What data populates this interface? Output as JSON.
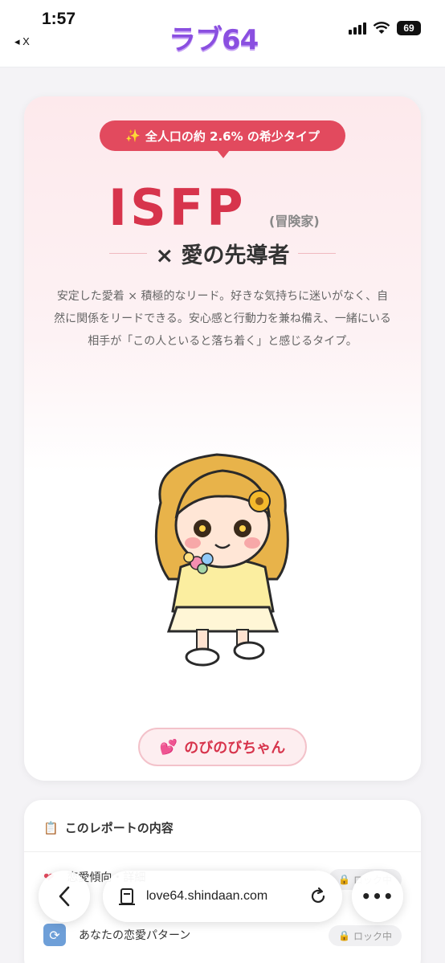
{
  "status_bar": {
    "time": "1:57",
    "back_label": "◂ X",
    "battery": "69"
  },
  "app": {
    "logo": "ラブ64"
  },
  "result": {
    "rarity_badge": "全人口の約 2.6% の希少タイプ",
    "sparkle": "✨",
    "type_code": "ISFP",
    "type_name": "(冒険家)",
    "subtitle": "× 愛の先導者",
    "description": "安定した愛着 × 積極的なリード。好きな気持ちに迷いがなく、自然に関係をリードできる。安心感と行動力を兼ね備え、一緒にいる相手が「この人といると落ち着く」と感じるタイプ。",
    "nickname_icon": "💕",
    "nickname": "のびのびちゃん"
  },
  "report": {
    "icon": "📋",
    "title": "このレポートの内容",
    "items": [
      {
        "label": "恋愛傾向・詳細",
        "status": "ロック中"
      },
      {
        "label": "あなたの恋愛パターン",
        "status": "ロック中"
      }
    ]
  },
  "browser": {
    "url": "love64.shindaan.com",
    "more_label": "•••"
  },
  "colors": {
    "accent": "#e24a5e",
    "type_color": "#d7344c",
    "logo": "#8a4fe0"
  }
}
